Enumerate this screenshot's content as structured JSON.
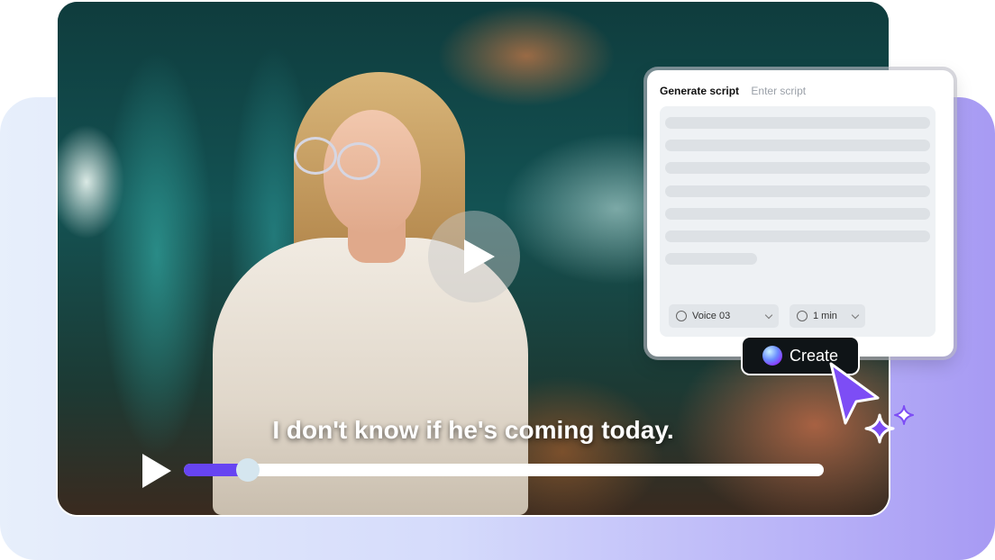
{
  "video": {
    "subtitle": "I don't know if he's coming today.",
    "progress": 0.1
  },
  "script_panel": {
    "tabs": [
      {
        "label": "Generate script",
        "active": true
      },
      {
        "label": "Enter script",
        "active": false
      }
    ],
    "voice_select": {
      "value": "Voice 03",
      "icon": "voice-icon"
    },
    "duration_select": {
      "value": "1 min",
      "icon": "clock-icon"
    }
  },
  "create_button": {
    "label": "Create",
    "icon": "gradient-orb-icon"
  },
  "colors": {
    "accent": "#6644f2",
    "button_bg": "#0f1417",
    "cursor": "#7d4df5"
  }
}
